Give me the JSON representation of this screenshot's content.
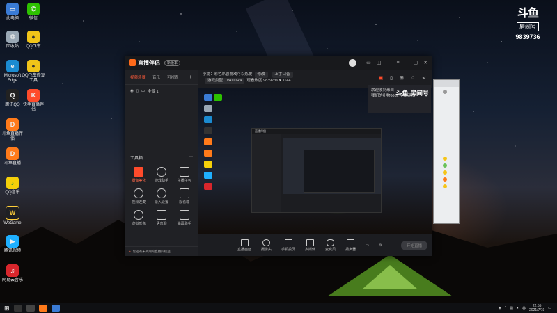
{
  "desktop_icons": [
    {
      "label": "此电脑",
      "color": "#3a7bd5",
      "glyph": "▭"
    },
    {
      "label": "微信",
      "color": "#2dc100",
      "glyph": "✆"
    },
    {
      "label": "回收站",
      "color": "#9aa8b5",
      "glyph": "♲"
    },
    {
      "label": "QQ飞车",
      "color": "#f0c419",
      "glyph": "●"
    },
    {
      "label": "Microsoft Edge",
      "color": "#1b8bd1",
      "glyph": "e"
    },
    {
      "label": "QQ飞车修复工具",
      "color": "#f0c419",
      "glyph": "●"
    },
    {
      "label": "腾讯QQ",
      "color": "#222",
      "glyph": "Q"
    },
    {
      "label": "快手直播伴侣",
      "color": "#ff4b2b",
      "glyph": "K"
    },
    {
      "label": "斗鱼直播伴侣",
      "color": "#ff7a1a",
      "glyph": "D"
    },
    {
      "label": "斗鱼直播",
      "color": "#ff7a1a",
      "glyph": "D"
    },
    {
      "label": "QQ音乐",
      "color": "#f5d00a",
      "glyph": "♪"
    },
    {
      "label": "WeGame",
      "color": "#1f2024",
      "glyph": "W"
    },
    {
      "label": "腾讯视频",
      "color": "#1fb0ff",
      "glyph": "▶"
    },
    {
      "label": "网易云音乐",
      "color": "#d8262c",
      "glyph": "♫"
    }
  ],
  "douyu": {
    "logo": "斗鱼",
    "room_label": "房间号",
    "room_number": "9839736"
  },
  "app": {
    "title": "直播伴侣",
    "version_pill": "新版本",
    "tabs": [
      "视频场景",
      "音乐",
      "可视表"
    ],
    "scene_label": "全景 1",
    "tools_header": "工具箱",
    "tools_more": "···",
    "tools": [
      {
        "label": "摄像美化"
      },
      {
        "label": "游戏助手"
      },
      {
        "label": "主播任务"
      },
      {
        "label": "视频连麦"
      },
      {
        "label": "录入设置"
      },
      {
        "label": "观看端"
      },
      {
        "label": "虚拟形象"
      },
      {
        "label": "语音聊"
      },
      {
        "label": "弹幕助手"
      }
    ],
    "notice": "您还有未到期的直播间权益",
    "info": {
      "title_prefix": "小提：",
      "title_text": "彩色爪冒游戏可以炼爱",
      "edit_btn": "修改",
      "category": "上手口音",
      "category_prefix": "游戏类型：",
      "game": "VALORA",
      "online_label": "观看热度",
      "online_value": "9839736",
      "fans": "1144"
    },
    "bottom_buttons": [
      "直播画面",
      "摄像头",
      "手机投屏",
      "多媒体",
      "麦克风",
      "扬声器"
    ],
    "start_button": "开始直播",
    "chat_lines": [
      "欢迎收到来自",
      "我们的礼物666x 全新宠物"
    ],
    "chat_logo": "斗鱼 房间号"
  },
  "taskbar": {
    "time": "22:55",
    "date": "2021/7/19"
  }
}
